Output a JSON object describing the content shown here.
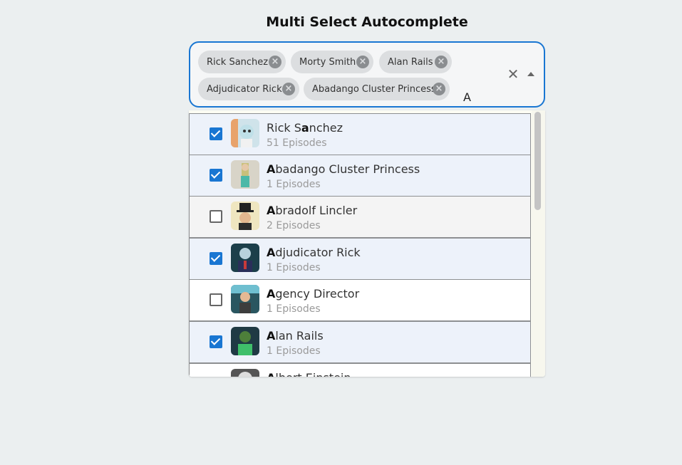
{
  "title": "Multi Select Autocomplete",
  "input": {
    "chips": [
      {
        "label": "Rick Sanchez"
      },
      {
        "label": "Morty Smith"
      },
      {
        "label": "Alan Rails"
      },
      {
        "label": "Adjudicator Rick"
      },
      {
        "label": "Abadango Cluster Princess"
      }
    ],
    "typed_value": "A",
    "clear_icon": "close-icon",
    "open_icon": "arrow-up-icon",
    "accent": "#1976d2"
  },
  "options": [
    {
      "name_bold": "",
      "name_rest": "Rick S",
      "name_bold2": "a",
      "name_tail": "nchez",
      "episodes": "51 Episodes",
      "checked": true
    },
    {
      "name_bold": "A",
      "name_rest": "badango Cluster Princess",
      "name_bold2": "",
      "name_tail": "",
      "episodes": "1 Episodes",
      "checked": true
    },
    {
      "name_bold": "A",
      "name_rest": "bradolf Lincler",
      "name_bold2": "",
      "name_tail": "",
      "episodes": "2 Episodes",
      "checked": false
    },
    {
      "name_bold": "A",
      "name_rest": "djudicator Rick",
      "name_bold2": "",
      "name_tail": "",
      "episodes": "1 Episodes",
      "checked": true
    },
    {
      "name_bold": "A",
      "name_rest": "gency Director",
      "name_bold2": "",
      "name_tail": "",
      "episodes": "1 Episodes",
      "checked": false
    },
    {
      "name_bold": "A",
      "name_rest": "lan Rails",
      "name_bold2": "",
      "name_tail": "",
      "episodes": "1 Episodes",
      "checked": true
    },
    {
      "name_bold": "A",
      "name_rest": "lbert Einstein",
      "name_bold2": "",
      "name_tail": "",
      "episodes": "",
      "checked": false
    }
  ]
}
